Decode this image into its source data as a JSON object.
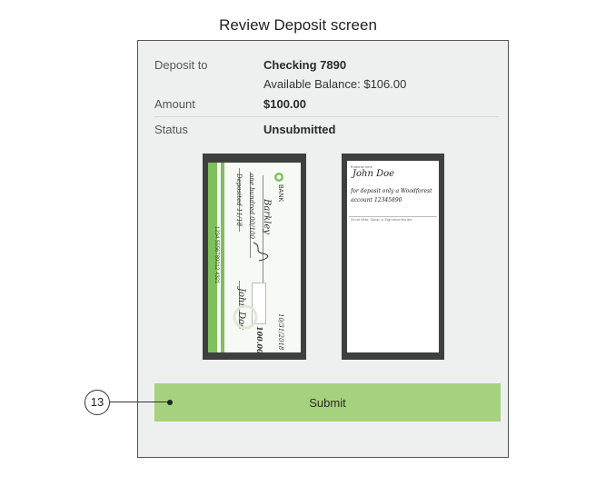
{
  "page": {
    "title": "Review Deposit screen"
  },
  "details": {
    "deposit_to_label": "Deposit to",
    "account_name": "Checking 7890",
    "available_balance": "Available Balance: $106.00",
    "amount_label": "Amount",
    "amount_value": "$100.00",
    "status_label": "Status",
    "status_value": "Unsubmitted"
  },
  "check_front": {
    "bank_name": "BANK",
    "payee": "Barkley",
    "amount_words": "one hundred 00/100",
    "memo": "Deposited 11/18",
    "date": "10/31/2018",
    "amount_box": "100.00",
    "signature": "John Doe",
    "micr": "1234  5556789012  4321"
  },
  "check_back": {
    "endorse_label": "Endorse here",
    "signature": "John Doe",
    "restriction": "for deposit only a Woodforest",
    "account": "account 12345890",
    "fine_print": "Do not Write, Stamp, or Sign below this line"
  },
  "actions": {
    "submit_label": "Submit"
  },
  "callouts": [
    {
      "number": "13"
    }
  ],
  "colors": {
    "accent_green": "#a6d27d",
    "stripe_green": "#7fbf5c",
    "frame_bg": "#eef0f0"
  }
}
